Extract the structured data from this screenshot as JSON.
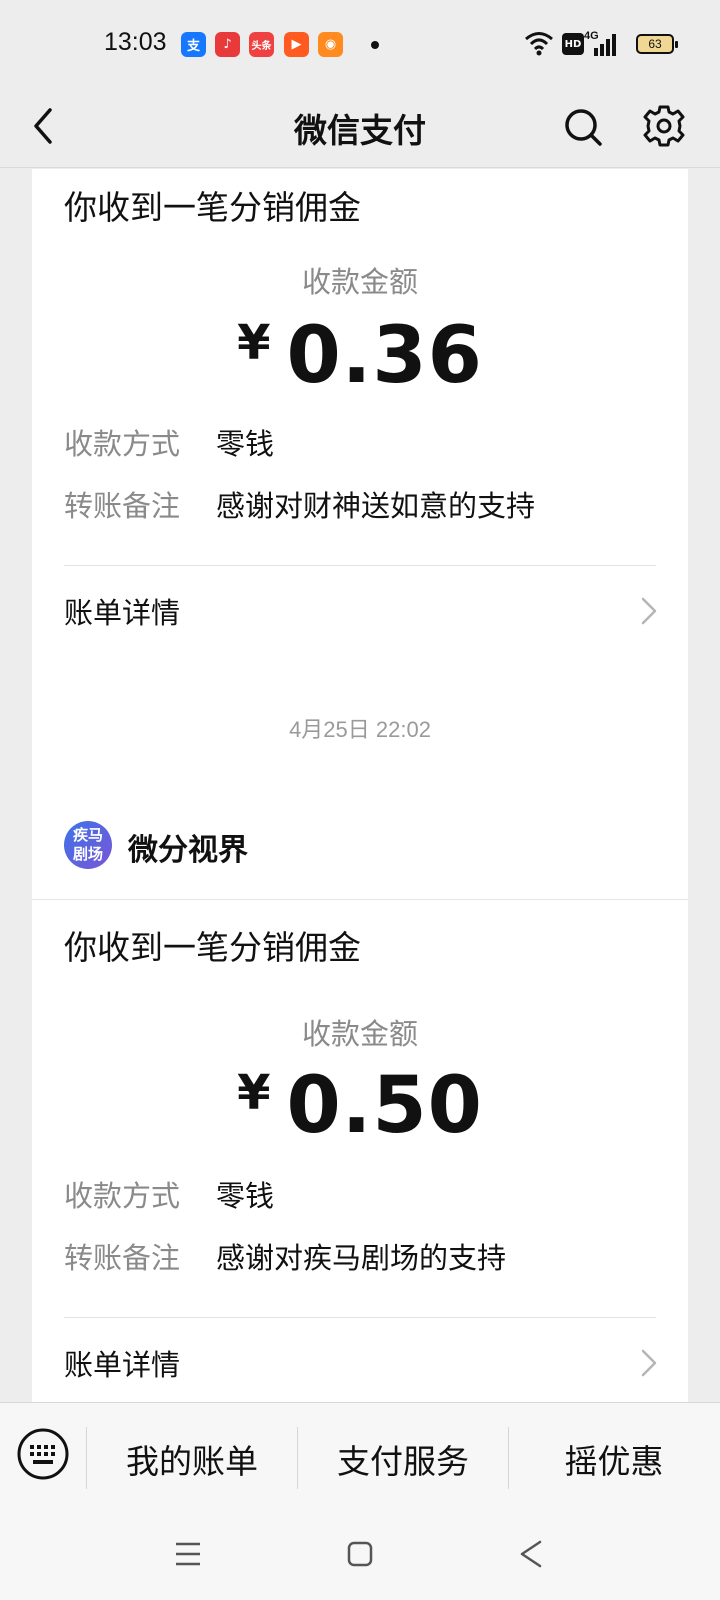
{
  "status_bar": {
    "time": "13:03",
    "apps": [
      {
        "name": "alipay",
        "glyph": "支",
        "color": "#1677ff"
      },
      {
        "name": "music",
        "glyph": "♪",
        "color": "#e83a3a"
      },
      {
        "name": "toutiao",
        "glyph": "头条",
        "color": "#f04142"
      },
      {
        "name": "video",
        "glyph": "▶",
        "color": "#ff5a1f"
      },
      {
        "name": "store",
        "glyph": "◉",
        "color": "#ff8a1f"
      }
    ],
    "network": "4G",
    "hd_label": "HD",
    "battery": "63"
  },
  "header": {
    "title": "微信支付"
  },
  "cards": [
    {
      "message_title": "你收到一笔分销佣金",
      "amount_label": "收款金额",
      "currency": "¥",
      "amount": "0.36",
      "method_label": "收款方式",
      "method_value": "零钱",
      "note_label": "转账备注",
      "note_value": "感谢对财神送如意的支持",
      "detail_label": "账单详情"
    },
    {
      "merchant_logo_text": "疾马剧场",
      "merchant_name": "微分视界",
      "message_title": "你收到一笔分销佣金",
      "amount_label": "收款金额",
      "currency": "¥",
      "amount": "0.50",
      "method_label": "收款方式",
      "method_value": "零钱",
      "note_label": "转账备注",
      "note_value": "感谢对疾马剧场的支持",
      "detail_label": "账单详情"
    }
  ],
  "date_separator": "4月25日 22:02",
  "bottom_menu": {
    "items": [
      "我的账单",
      "支付服务",
      "摇优惠"
    ]
  },
  "colors": {
    "background": "#ededed",
    "card": "#ffffff",
    "secondary_text": "#8a8a8a"
  }
}
